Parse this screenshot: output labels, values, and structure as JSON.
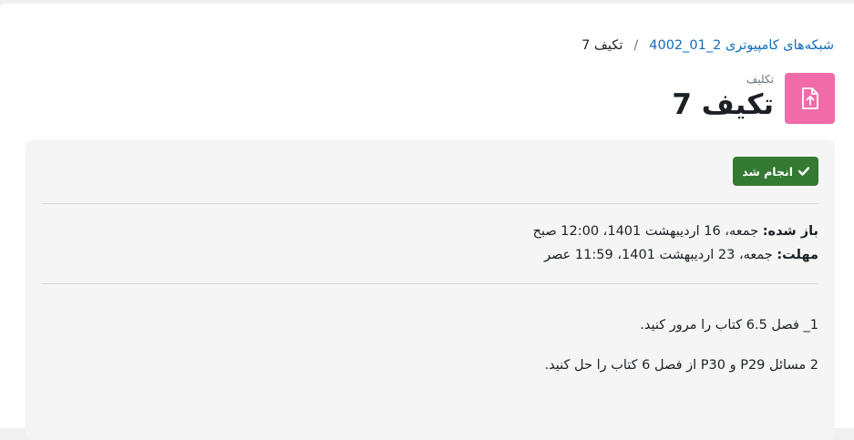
{
  "breadcrumb": {
    "course": "شبکه‌های کامپیوتری 2_01_4002",
    "separator": "/",
    "current": "تکیف 7"
  },
  "header": {
    "activity_type": "تکلیف",
    "title": "تکیف 7",
    "icon": "assignment-upload-icon",
    "icon_bg": "#f06ba7"
  },
  "completion": {
    "label": "انجام شد",
    "color": "#357a32"
  },
  "dates": {
    "opened_label": "باز شده:",
    "opened_value": "جمعه، 16 اردیبهشت 1401، 12:00 صبح",
    "due_label": "مهلت:",
    "due_value": "جمعه، 23 اردیبهشت 1401، 11:59 عصر"
  },
  "description": {
    "line1": "1_ فصل 6.5 کتاب را مرور کنید.",
    "line2": "2 مسائل P29  و  P30 از فصل 6 کتاب را حل کنید."
  }
}
